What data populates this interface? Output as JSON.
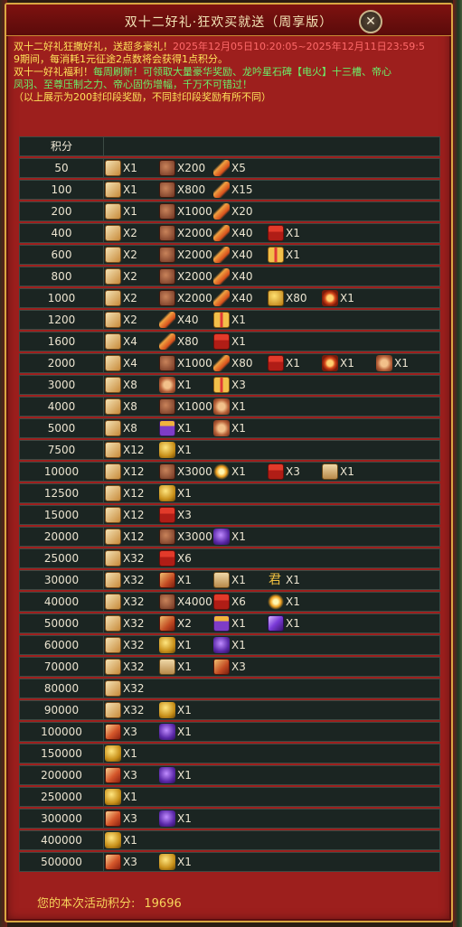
{
  "window": {
    "title": "双十二好礼·狂欢买就送（周享版）"
  },
  "notice": {
    "line1_a": "双十二好礼狂撒好礼，送超多豪礼！",
    "line1_b": "2025年12月05日10:20:05~2025年12月11日23:59:5",
    "line2": "9期间，每消耗1元征途2点数将会获得1点积分。",
    "line3_a": "双十一好礼福利！",
    "line3_b": "每周刷新！可领取大量豪华奖励、龙吟星石碑【电火】十三槽、帝心",
    "line4": "凤羽、至尊压制之力、帝心固伤增幅，千万不可错过！",
    "line5": "（以上展示为200封印段奖励，不同封印段奖励有所不同）"
  },
  "table": {
    "header_label": "积分",
    "rows": [
      {
        "score": "50",
        "items": [
          {
            "icon": "scroll-icon",
            "qty": "X1"
          },
          {
            "icon": "ore-icon",
            "qty": "X200"
          },
          {
            "icon": "feather-icon",
            "qty": "X5"
          }
        ]
      },
      {
        "score": "100",
        "items": [
          {
            "icon": "scroll-icon",
            "qty": "X1"
          },
          {
            "icon": "ore-icon",
            "qty": "X800"
          },
          {
            "icon": "feather-icon",
            "qty": "X15"
          }
        ]
      },
      {
        "score": "200",
        "items": [
          {
            "icon": "scroll-icon",
            "qty": "X1"
          },
          {
            "icon": "ore-icon",
            "qty": "X1000"
          },
          {
            "icon": "feather-icon",
            "qty": "X20"
          }
        ]
      },
      {
        "score": "400",
        "items": [
          {
            "icon": "scroll-icon",
            "qty": "X2"
          },
          {
            "icon": "ore-icon",
            "qty": "X2000"
          },
          {
            "icon": "feather-icon",
            "qty": "X40"
          },
          {
            "icon": "gift-icon",
            "qty": "X1"
          }
        ]
      },
      {
        "score": "600",
        "items": [
          {
            "icon": "scroll-icon",
            "qty": "X2"
          },
          {
            "icon": "ore-icon",
            "qty": "X2000"
          },
          {
            "icon": "feather-icon",
            "qty": "X40"
          },
          {
            "icon": "gold-gift-icon",
            "qty": "X1"
          }
        ]
      },
      {
        "score": "800",
        "items": [
          {
            "icon": "scroll-icon",
            "qty": "X2"
          },
          {
            "icon": "ore-icon",
            "qty": "X2000"
          },
          {
            "icon": "feather-icon",
            "qty": "X40"
          }
        ]
      },
      {
        "score": "1000",
        "items": [
          {
            "icon": "scroll-icon",
            "qty": "X2"
          },
          {
            "icon": "ore-icon",
            "qty": "X2000"
          },
          {
            "icon": "feather-icon",
            "qty": "X40"
          },
          {
            "icon": "coin-icon",
            "qty": "X80"
          },
          {
            "icon": "flame-orb-icon",
            "qty": "X1"
          }
        ]
      },
      {
        "score": "1200",
        "items": [
          {
            "icon": "scroll-icon",
            "qty": "X2"
          },
          {
            "icon": "feather-icon",
            "qty": "X40"
          },
          {
            "icon": "gold-gift-icon",
            "qty": "X1"
          }
        ]
      },
      {
        "score": "1600",
        "items": [
          {
            "icon": "scroll-icon",
            "qty": "X4"
          },
          {
            "icon": "feather-icon",
            "qty": "X80"
          },
          {
            "icon": "gift-icon",
            "qty": "X1"
          }
        ]
      },
      {
        "score": "2000",
        "items": [
          {
            "icon": "scroll-icon",
            "qty": "X4"
          },
          {
            "icon": "ore-icon",
            "qty": "X1000"
          },
          {
            "icon": "feather-icon",
            "qty": "X80"
          },
          {
            "icon": "gift-icon",
            "qty": "X1"
          },
          {
            "icon": "flame-orb-icon",
            "qty": "X1"
          },
          {
            "icon": "seal-icon",
            "qty": "X1"
          }
        ]
      },
      {
        "score": "3000",
        "items": [
          {
            "icon": "scroll-icon",
            "qty": "X8"
          },
          {
            "icon": "seal-icon",
            "qty": "X1"
          },
          {
            "icon": "gold-gift-icon",
            "qty": "X3"
          }
        ]
      },
      {
        "score": "4000",
        "items": [
          {
            "icon": "scroll-icon",
            "qty": "X8"
          },
          {
            "icon": "ore-icon",
            "qty": "X1000"
          },
          {
            "icon": "seal-icon",
            "qty": "X1"
          }
        ]
      },
      {
        "score": "5000",
        "items": [
          {
            "icon": "scroll-icon",
            "qty": "X8"
          },
          {
            "icon": "purple-gift-icon",
            "qty": "X1"
          },
          {
            "icon": "seal-icon",
            "qty": "X1"
          }
        ]
      },
      {
        "score": "7500",
        "items": [
          {
            "icon": "scroll-icon",
            "qty": "X12"
          },
          {
            "icon": "gold-orb-icon",
            "qty": "X1"
          }
        ]
      },
      {
        "score": "10000",
        "items": [
          {
            "icon": "scroll-icon",
            "qty": "X12"
          },
          {
            "icon": "ore-icon",
            "qty": "X3000"
          },
          {
            "icon": "spark-icon",
            "qty": "X1"
          },
          {
            "icon": "gift-icon",
            "qty": "X3"
          },
          {
            "icon": "treasure-box-icon",
            "qty": "X1"
          }
        ]
      },
      {
        "score": "12500",
        "items": [
          {
            "icon": "scroll-icon",
            "qty": "X12"
          },
          {
            "icon": "gold-orb-icon",
            "qty": "X1"
          }
        ]
      },
      {
        "score": "15000",
        "items": [
          {
            "icon": "scroll-icon",
            "qty": "X12"
          },
          {
            "icon": "gift-icon",
            "qty": "X3"
          }
        ]
      },
      {
        "score": "20000",
        "items": [
          {
            "icon": "scroll-icon",
            "qty": "X12"
          },
          {
            "icon": "ore-icon",
            "qty": "X3000"
          },
          {
            "icon": "gem-icon",
            "qty": "X1"
          }
        ]
      },
      {
        "score": "25000",
        "items": [
          {
            "icon": "scroll-icon",
            "qty": "X32"
          },
          {
            "icon": "gift-icon",
            "qty": "X6"
          }
        ]
      },
      {
        "score": "30000",
        "items": [
          {
            "icon": "scroll-icon",
            "qty": "X32"
          },
          {
            "icon": "talisman-icon",
            "qty": "X1"
          },
          {
            "icon": "treasure-box-icon",
            "qty": "X1"
          },
          {
            "icon": "jun-icon",
            "qty": "X1"
          }
        ]
      },
      {
        "score": "40000",
        "items": [
          {
            "icon": "scroll-icon",
            "qty": "X32"
          },
          {
            "icon": "ore-icon",
            "qty": "X4000"
          },
          {
            "icon": "gift-icon",
            "qty": "X6"
          },
          {
            "icon": "spark-icon",
            "qty": "X1"
          }
        ]
      },
      {
        "score": "50000",
        "items": [
          {
            "icon": "scroll-icon",
            "qty": "X32"
          },
          {
            "icon": "talisman-icon",
            "qty": "X2"
          },
          {
            "icon": "purple-gift-icon",
            "qty": "X1"
          },
          {
            "icon": "crystal-icon",
            "qty": "X1"
          }
        ]
      },
      {
        "score": "60000",
        "items": [
          {
            "icon": "scroll-icon",
            "qty": "X32"
          },
          {
            "icon": "gold-orb-icon",
            "qty": "X1"
          },
          {
            "icon": "gem-icon",
            "qty": "X1"
          }
        ]
      },
      {
        "score": "70000",
        "items": [
          {
            "icon": "scroll-icon",
            "qty": "X32"
          },
          {
            "icon": "treasure-box-icon",
            "qty": "X1"
          },
          {
            "icon": "talisman-icon",
            "qty": "X3"
          }
        ]
      },
      {
        "score": "80000",
        "items": [
          {
            "icon": "scroll-icon",
            "qty": "X32"
          }
        ]
      },
      {
        "score": "90000",
        "items": [
          {
            "icon": "scroll-icon",
            "qty": "X32"
          },
          {
            "icon": "gold-orb-icon",
            "qty": "X1"
          }
        ]
      },
      {
        "score": "100000",
        "items": [
          {
            "icon": "tianshu-icon",
            "qty": "X3"
          },
          {
            "icon": "gem-icon",
            "qty": "X1"
          }
        ]
      },
      {
        "score": "150000",
        "items": [
          {
            "icon": "gold-orb-icon",
            "qty": "X1"
          }
        ]
      },
      {
        "score": "200000",
        "items": [
          {
            "icon": "tianshu-icon",
            "qty": "X3"
          },
          {
            "icon": "gem-icon",
            "qty": "X1"
          }
        ]
      },
      {
        "score": "250000",
        "items": [
          {
            "icon": "gold-orb-icon",
            "qty": "X1"
          }
        ]
      },
      {
        "score": "300000",
        "items": [
          {
            "icon": "tianshu-icon",
            "qty": "X3"
          },
          {
            "icon": "gem-icon",
            "qty": "X1"
          }
        ]
      },
      {
        "score": "400000",
        "items": [
          {
            "icon": "gold-orb-icon",
            "qty": "X1"
          }
        ]
      },
      {
        "score": "500000",
        "items": [
          {
            "icon": "tianshu-icon",
            "qty": "X3"
          },
          {
            "icon": "gold-orb-icon",
            "qty": "X1"
          }
        ]
      }
    ]
  },
  "footer": {
    "label": "您的本次活动积分:",
    "value": "19696"
  },
  "colors": {
    "panel": "#9d1f1d",
    "border": "#d9a742",
    "row": "#1b2522",
    "notice_yellow": "#ffe35a",
    "notice_green": "#6af06a",
    "footer_text": "#f7d35a"
  }
}
